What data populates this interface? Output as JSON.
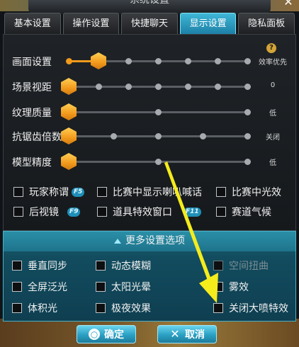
{
  "window": {
    "title": "系统设置",
    "close_icon": "close-x-icon"
  },
  "tabs": [
    {
      "label": "基本设置",
      "active": false
    },
    {
      "label": "操作设置",
      "active": false
    },
    {
      "label": "快捷聊天",
      "active": false
    },
    {
      "label": "显示设置",
      "active": true
    },
    {
      "label": "隐私面板",
      "active": false
    }
  ],
  "help_icon_text": "?",
  "sliders": [
    {
      "label": "画面设置",
      "level": 1,
      "steps": 7,
      "value_text": "效率优先"
    },
    {
      "label": "场景视距",
      "level": 0,
      "steps": 7,
      "value_text": "0"
    },
    {
      "label": "纹理质量",
      "level": 0,
      "steps": 3,
      "value_text": "低"
    },
    {
      "label": "抗锯齿倍数",
      "level": 0,
      "steps": 5,
      "value_text": "关闭"
    },
    {
      "label": "模型精度",
      "level": 0,
      "steps": 3,
      "value_text": "低"
    }
  ],
  "options": [
    {
      "label": "玩家称谓",
      "checked": false,
      "hotkey": "F5"
    },
    {
      "label": "比赛中显示喇叭喊话",
      "checked": false,
      "hotkey": ""
    },
    {
      "label": "比赛中光效",
      "checked": false,
      "hotkey": ""
    },
    {
      "label": "后视镜",
      "checked": false,
      "hotkey": "F9"
    },
    {
      "label": "道具特效窗口",
      "checked": false,
      "hotkey": "F11"
    },
    {
      "label": "赛道气候",
      "checked": false,
      "hotkey": ""
    }
  ],
  "more_settings": {
    "header": "更多设置选项",
    "options": [
      {
        "label": "垂直同步",
        "checked": false,
        "disabled": false
      },
      {
        "label": "动态模糊",
        "checked": false,
        "disabled": false
      },
      {
        "label": "空间扭曲",
        "checked": false,
        "disabled": true
      },
      {
        "label": "全屏泛光",
        "checked": false,
        "disabled": false
      },
      {
        "label": "太阳光晕",
        "checked": false,
        "disabled": false
      },
      {
        "label": "雾效",
        "checked": false,
        "disabled": false
      },
      {
        "label": "体积光",
        "checked": false,
        "disabled": false
      },
      {
        "label": "极夜效果",
        "checked": false,
        "disabled": false
      },
      {
        "label": "关闭大喷特效",
        "checked": false,
        "disabled": false
      }
    ]
  },
  "buttons": {
    "ok": {
      "label": "确定",
      "icon": "circle-icon"
    },
    "cancel": {
      "label": "取消",
      "icon": "x-icon"
    }
  },
  "colors": {
    "accent": "#f29a1c",
    "active_tab": "#3fb7d6",
    "annotation_arrow": "#f5ec1c"
  }
}
